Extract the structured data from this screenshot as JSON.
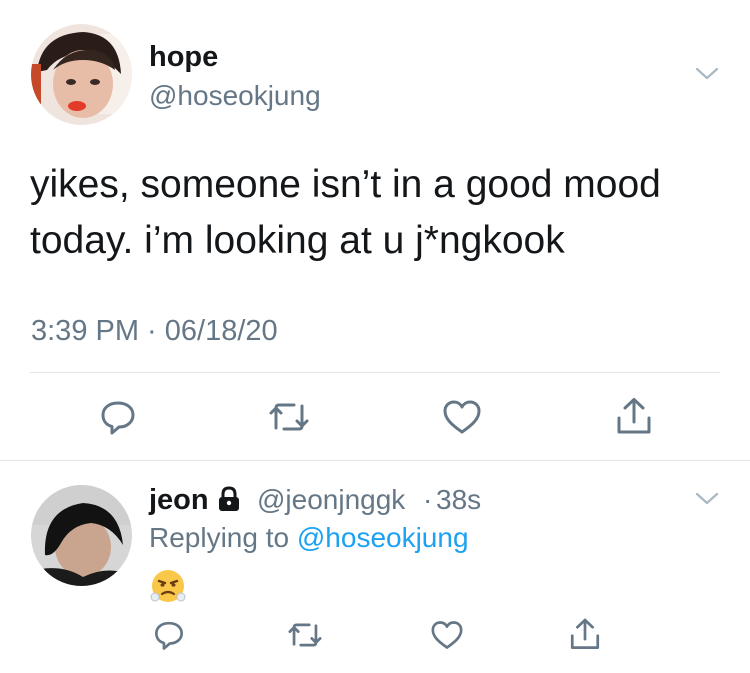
{
  "main_tweet": {
    "author": {
      "name": "hope",
      "handle": "@hoseokjung"
    },
    "text_line1": "yikes, someone isn’t in a good mood",
    "text_line2": "today. i’m looking at u j*ngkook",
    "timestamp": "3:39 PM · 06/18/20"
  },
  "reply": {
    "author": {
      "name": "jeon",
      "handle": "@jeonjnggk",
      "dot": "·",
      "time": "38s"
    },
    "replying_prefix": "Replying to",
    "replying_to": "@hoseokjung",
    "emoji": "😤"
  },
  "icons": {
    "reply": "reply-icon",
    "retweet": "retweet-icon",
    "like": "heart-icon",
    "share": "share-icon",
    "menu": "chevron-down-icon",
    "lock": "lock-icon"
  },
  "colors": {
    "text": "#14171a",
    "secondary": "#657786",
    "link": "#1da1f2",
    "divider": "#e1e8ed"
  }
}
